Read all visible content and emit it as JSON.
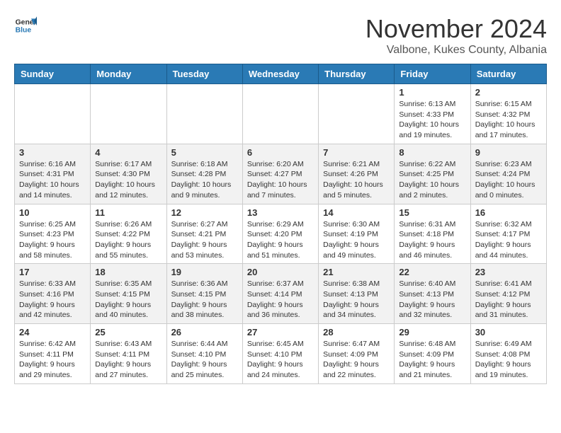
{
  "header": {
    "logo_general": "General",
    "logo_blue": "Blue",
    "month_year": "November 2024",
    "location": "Valbone, Kukes County, Albania"
  },
  "weekdays": [
    "Sunday",
    "Monday",
    "Tuesday",
    "Wednesday",
    "Thursday",
    "Friday",
    "Saturday"
  ],
  "weeks": [
    [
      {
        "day": "",
        "info": ""
      },
      {
        "day": "",
        "info": ""
      },
      {
        "day": "",
        "info": ""
      },
      {
        "day": "",
        "info": ""
      },
      {
        "day": "",
        "info": ""
      },
      {
        "day": "1",
        "info": "Sunrise: 6:13 AM\nSunset: 4:33 PM\nDaylight: 10 hours and 19 minutes."
      },
      {
        "day": "2",
        "info": "Sunrise: 6:15 AM\nSunset: 4:32 PM\nDaylight: 10 hours and 17 minutes."
      }
    ],
    [
      {
        "day": "3",
        "info": "Sunrise: 6:16 AM\nSunset: 4:31 PM\nDaylight: 10 hours and 14 minutes."
      },
      {
        "day": "4",
        "info": "Sunrise: 6:17 AM\nSunset: 4:30 PM\nDaylight: 10 hours and 12 minutes."
      },
      {
        "day": "5",
        "info": "Sunrise: 6:18 AM\nSunset: 4:28 PM\nDaylight: 10 hours and 9 minutes."
      },
      {
        "day": "6",
        "info": "Sunrise: 6:20 AM\nSunset: 4:27 PM\nDaylight: 10 hours and 7 minutes."
      },
      {
        "day": "7",
        "info": "Sunrise: 6:21 AM\nSunset: 4:26 PM\nDaylight: 10 hours and 5 minutes."
      },
      {
        "day": "8",
        "info": "Sunrise: 6:22 AM\nSunset: 4:25 PM\nDaylight: 10 hours and 2 minutes."
      },
      {
        "day": "9",
        "info": "Sunrise: 6:23 AM\nSunset: 4:24 PM\nDaylight: 10 hours and 0 minutes."
      }
    ],
    [
      {
        "day": "10",
        "info": "Sunrise: 6:25 AM\nSunset: 4:23 PM\nDaylight: 9 hours and 58 minutes."
      },
      {
        "day": "11",
        "info": "Sunrise: 6:26 AM\nSunset: 4:22 PM\nDaylight: 9 hours and 55 minutes."
      },
      {
        "day": "12",
        "info": "Sunrise: 6:27 AM\nSunset: 4:21 PM\nDaylight: 9 hours and 53 minutes."
      },
      {
        "day": "13",
        "info": "Sunrise: 6:29 AM\nSunset: 4:20 PM\nDaylight: 9 hours and 51 minutes."
      },
      {
        "day": "14",
        "info": "Sunrise: 6:30 AM\nSunset: 4:19 PM\nDaylight: 9 hours and 49 minutes."
      },
      {
        "day": "15",
        "info": "Sunrise: 6:31 AM\nSunset: 4:18 PM\nDaylight: 9 hours and 46 minutes."
      },
      {
        "day": "16",
        "info": "Sunrise: 6:32 AM\nSunset: 4:17 PM\nDaylight: 9 hours and 44 minutes."
      }
    ],
    [
      {
        "day": "17",
        "info": "Sunrise: 6:33 AM\nSunset: 4:16 PM\nDaylight: 9 hours and 42 minutes."
      },
      {
        "day": "18",
        "info": "Sunrise: 6:35 AM\nSunset: 4:15 PM\nDaylight: 9 hours and 40 minutes."
      },
      {
        "day": "19",
        "info": "Sunrise: 6:36 AM\nSunset: 4:15 PM\nDaylight: 9 hours and 38 minutes."
      },
      {
        "day": "20",
        "info": "Sunrise: 6:37 AM\nSunset: 4:14 PM\nDaylight: 9 hours and 36 minutes."
      },
      {
        "day": "21",
        "info": "Sunrise: 6:38 AM\nSunset: 4:13 PM\nDaylight: 9 hours and 34 minutes."
      },
      {
        "day": "22",
        "info": "Sunrise: 6:40 AM\nSunset: 4:13 PM\nDaylight: 9 hours and 32 minutes."
      },
      {
        "day": "23",
        "info": "Sunrise: 6:41 AM\nSunset: 4:12 PM\nDaylight: 9 hours and 31 minutes."
      }
    ],
    [
      {
        "day": "24",
        "info": "Sunrise: 6:42 AM\nSunset: 4:11 PM\nDaylight: 9 hours and 29 minutes."
      },
      {
        "day": "25",
        "info": "Sunrise: 6:43 AM\nSunset: 4:11 PM\nDaylight: 9 hours and 27 minutes."
      },
      {
        "day": "26",
        "info": "Sunrise: 6:44 AM\nSunset: 4:10 PM\nDaylight: 9 hours and 25 minutes."
      },
      {
        "day": "27",
        "info": "Sunrise: 6:45 AM\nSunset: 4:10 PM\nDaylight: 9 hours and 24 minutes."
      },
      {
        "day": "28",
        "info": "Sunrise: 6:47 AM\nSunset: 4:09 PM\nDaylight: 9 hours and 22 minutes."
      },
      {
        "day": "29",
        "info": "Sunrise: 6:48 AM\nSunset: 4:09 PM\nDaylight: 9 hours and 21 minutes."
      },
      {
        "day": "30",
        "info": "Sunrise: 6:49 AM\nSunset: 4:08 PM\nDaylight: 9 hours and 19 minutes."
      }
    ]
  ]
}
